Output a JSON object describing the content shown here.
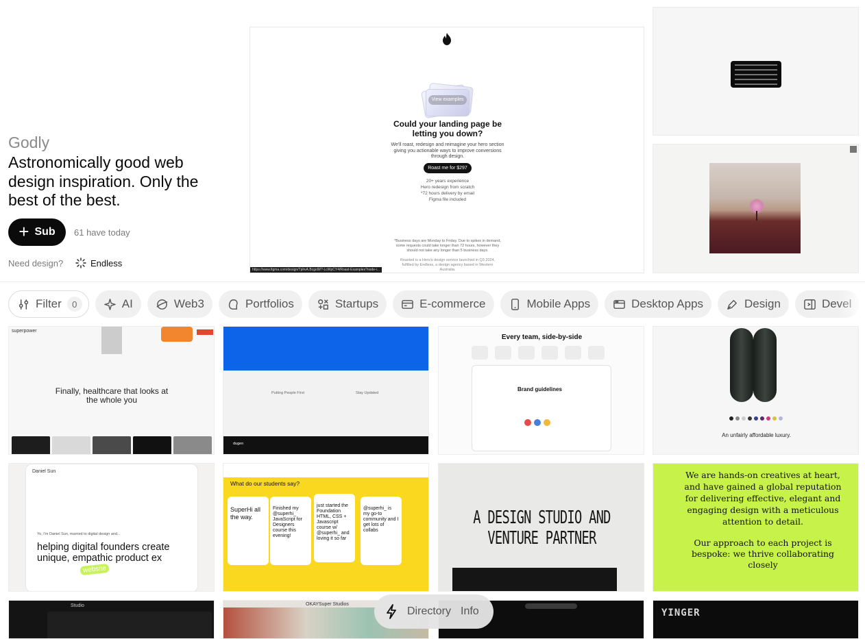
{
  "hero": {
    "brand": "Godly",
    "tagline": "Astronomically good web design inspiration. Only the best of the best.",
    "subscribe_label": "Sub",
    "subscriber_count": "61 have today",
    "need_design_label": "Need design?",
    "agency_label": "Endless"
  },
  "featured": {
    "view_examples": "View examples",
    "headline": "Could your landing page be letting you down?",
    "body": "We'll roast, redesign and reimagine your hero section giving you actionable ways to improve conversions through design.",
    "cta": "Roast me for $297",
    "features": [
      "20+ years experience",
      "Hero redesign from scratch",
      "*72 hours delivery by email",
      "Figma file included"
    ],
    "note": "*Business days are Monday to Friday. Due to spikes in demand, some requests could take longer than 72 hours, however they should not take any longer than 5 business days.",
    "footer": "Roasted is a Hero's design service launched in Q3 2024, fulfilled by Endless, a design agency based in Western Australia.",
    "status_url": "https://www.figma.com/design/TphvA.Bcgo9l/?-LcWpCY4/Roast-Examples?node-i..."
  },
  "filters": [
    {
      "label": "Filter",
      "icon": "filter-icon",
      "badge": "0"
    },
    {
      "label": "AI",
      "icon": "sparkle-icon"
    },
    {
      "label": "Web3",
      "icon": "planet-icon"
    },
    {
      "label": "Portfolios",
      "icon": "portfolio-icon"
    },
    {
      "label": "Startups",
      "icon": "shapes-icon"
    },
    {
      "label": "E-commerce",
      "icon": "card-icon"
    },
    {
      "label": "Mobile Apps",
      "icon": "phone-icon"
    },
    {
      "label": "Desktop Apps",
      "icon": "window-icon"
    },
    {
      "label": "Design",
      "icon": "pen-icon"
    },
    {
      "label": "Devel",
      "icon": "code-icon"
    }
  ],
  "tiles": {
    "t1": {
      "brand": "superpower",
      "headline": "Finally, healthcare that looks at the whole you"
    },
    "t2": {
      "left_heading": "Putting People First",
      "right_heading": "Stay Updated",
      "logo": "dugen"
    },
    "t3": {
      "headline": "Every team, side-by-side",
      "doc_title": "Brand guidelines",
      "icons": [
        "Engineering",
        "Design",
        "Product",
        "Marketing",
        "Operations",
        "HR"
      ]
    },
    "t4": {
      "caption": "An unfairly affordable luxury."
    },
    "t5": {
      "brand": "Daniel Sun",
      "intro": "Yo, I'm Daniel Sun, married to digital design and...",
      "headline": "helping digital founders create unique, empathic product ex",
      "sticker": "website"
    },
    "t6": {
      "question": "What do our students say?",
      "cards": [
        "SuperHi all the way.",
        "Finished my @superhi_ JavaScript for Designers course this evening!",
        "just started the Foundation HTML, CSS + Javascript course w/ @superhi_ and loving it so far",
        "@superhi_ is my go-to community and I get lots of collabs"
      ]
    },
    "t7": {
      "headline": "A DESIGN STUDIO AND VENTURE PARTNER"
    },
    "t8": {
      "para1": "We are hands-on creatives at heart, and have gained a global reputation for delivering effective, elegant and engaging design with a meticulous attention to detail.",
      "para2": "Our approach to each project is bespoke: we thrive collaborating closely"
    },
    "t9": {
      "title": "Studio"
    },
    "t10": {
      "title": "OKAYSuper Studios"
    },
    "t12": {
      "logo": "YINGER"
    }
  },
  "dock": {
    "directory": "Directory",
    "info": "Info"
  }
}
